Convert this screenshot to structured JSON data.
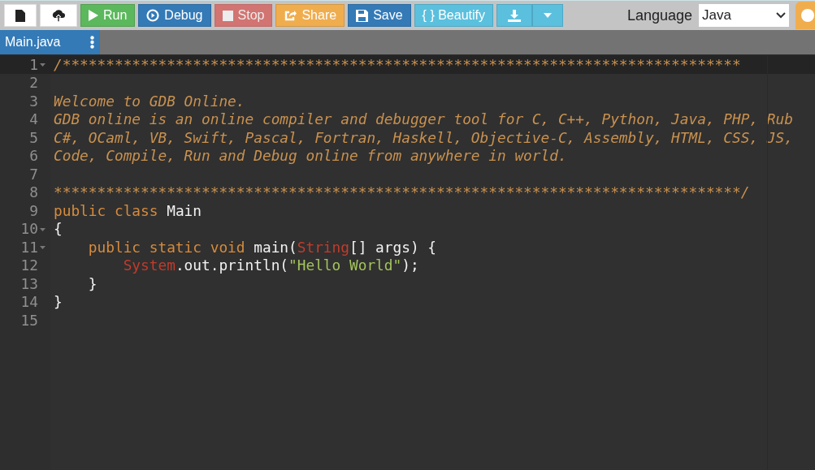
{
  "toolbar": {
    "buttons": [
      {
        "kind": "new-file",
        "disabled": false
      },
      {
        "kind": "upload",
        "disabled": false
      },
      {
        "kind": "run",
        "label": "Run",
        "disabled": false
      },
      {
        "kind": "debug",
        "label": "Debug",
        "disabled": false
      },
      {
        "kind": "stop",
        "label": "Stop",
        "disabled": true
      },
      {
        "kind": "share",
        "label": "Share",
        "disabled": false
      },
      {
        "kind": "save",
        "label": "Save",
        "disabled": false
      },
      {
        "kind": "beautify",
        "label": "{ } Beautify",
        "disabled": false
      },
      {
        "kind": "download",
        "disabled": false
      },
      {
        "kind": "more",
        "disabled": false
      }
    ],
    "language_label": "Language",
    "language_select": {
      "value": "Java"
    },
    "cut_button": {
      "kind": "settings"
    }
  },
  "tabs": [
    {
      "label": "Main.java",
      "selected": true
    }
  ],
  "editor": {
    "lines": [
      {
        "number": "1",
        "foldable": true,
        "active": true,
        "tokens": [
          {
            "kind": "comment",
            "text": "/******************************************************************************"
          }
        ]
      },
      {
        "number": "2",
        "foldable": false,
        "active": false
      },
      {
        "number": "3",
        "foldable": false,
        "active": false,
        "tokens": [
          {
            "kind": "comment",
            "text": "Welcome to GDB Online."
          }
        ]
      },
      {
        "number": "4",
        "foldable": false,
        "active": false,
        "tokens": [
          {
            "kind": "comment",
            "text": "GDB online is an online compiler and debugger tool for C, C++, Python, Java, PHP, Rub"
          }
        ]
      },
      {
        "number": "5",
        "foldable": false,
        "active": false,
        "tokens": [
          {
            "kind": "comment",
            "text": "C#, OCaml, VB, Swift, Pascal, Fortran, Haskell, Objective-C, Assembly, HTML, CSS, JS,"
          }
        ]
      },
      {
        "number": "6",
        "foldable": false,
        "active": false,
        "tokens": [
          {
            "kind": "comment",
            "text": "Code, Compile, Run and Debug online from anywhere in world."
          }
        ]
      },
      {
        "number": "7",
        "foldable": false,
        "active": false
      },
      {
        "number": "8",
        "foldable": false,
        "active": false,
        "tokens": [
          {
            "kind": "comment",
            "text": "*******************************************************************************/"
          }
        ]
      },
      {
        "number": "9",
        "foldable": false,
        "active": false,
        "tokens": [
          {
            "kind": "keyword",
            "text": "public class"
          },
          {
            "kind": "plain",
            "text": " Main"
          }
        ]
      },
      {
        "number": "10",
        "foldable": true,
        "active": false,
        "tokens": [
          {
            "kind": "plain",
            "text": "{"
          }
        ]
      },
      {
        "number": "11",
        "foldable": true,
        "active": false,
        "tokens": [
          {
            "kind": "keyword",
            "text": "    public static void"
          },
          {
            "kind": "plain",
            "text": " main("
          },
          {
            "kind": "type",
            "text": "String"
          },
          {
            "kind": "plain",
            "text": "[] args) {"
          }
        ]
      },
      {
        "number": "12",
        "foldable": false,
        "active": false,
        "tokens": [
          {
            "kind": "type",
            "text": "        System"
          },
          {
            "kind": "plain",
            "text": ".out.println("
          },
          {
            "kind": "string",
            "text": "\"Hello World\""
          },
          {
            "kind": "plain",
            "text": ");"
          }
        ]
      },
      {
        "number": "13",
        "foldable": false,
        "active": false,
        "tokens": [
          {
            "kind": "plain",
            "text": "    }"
          }
        ]
      },
      {
        "number": "14",
        "foldable": false,
        "active": false,
        "tokens": [
          {
            "kind": "plain",
            "text": "}"
          }
        ]
      },
      {
        "number": "15",
        "foldable": false,
        "active": false
      }
    ]
  }
}
